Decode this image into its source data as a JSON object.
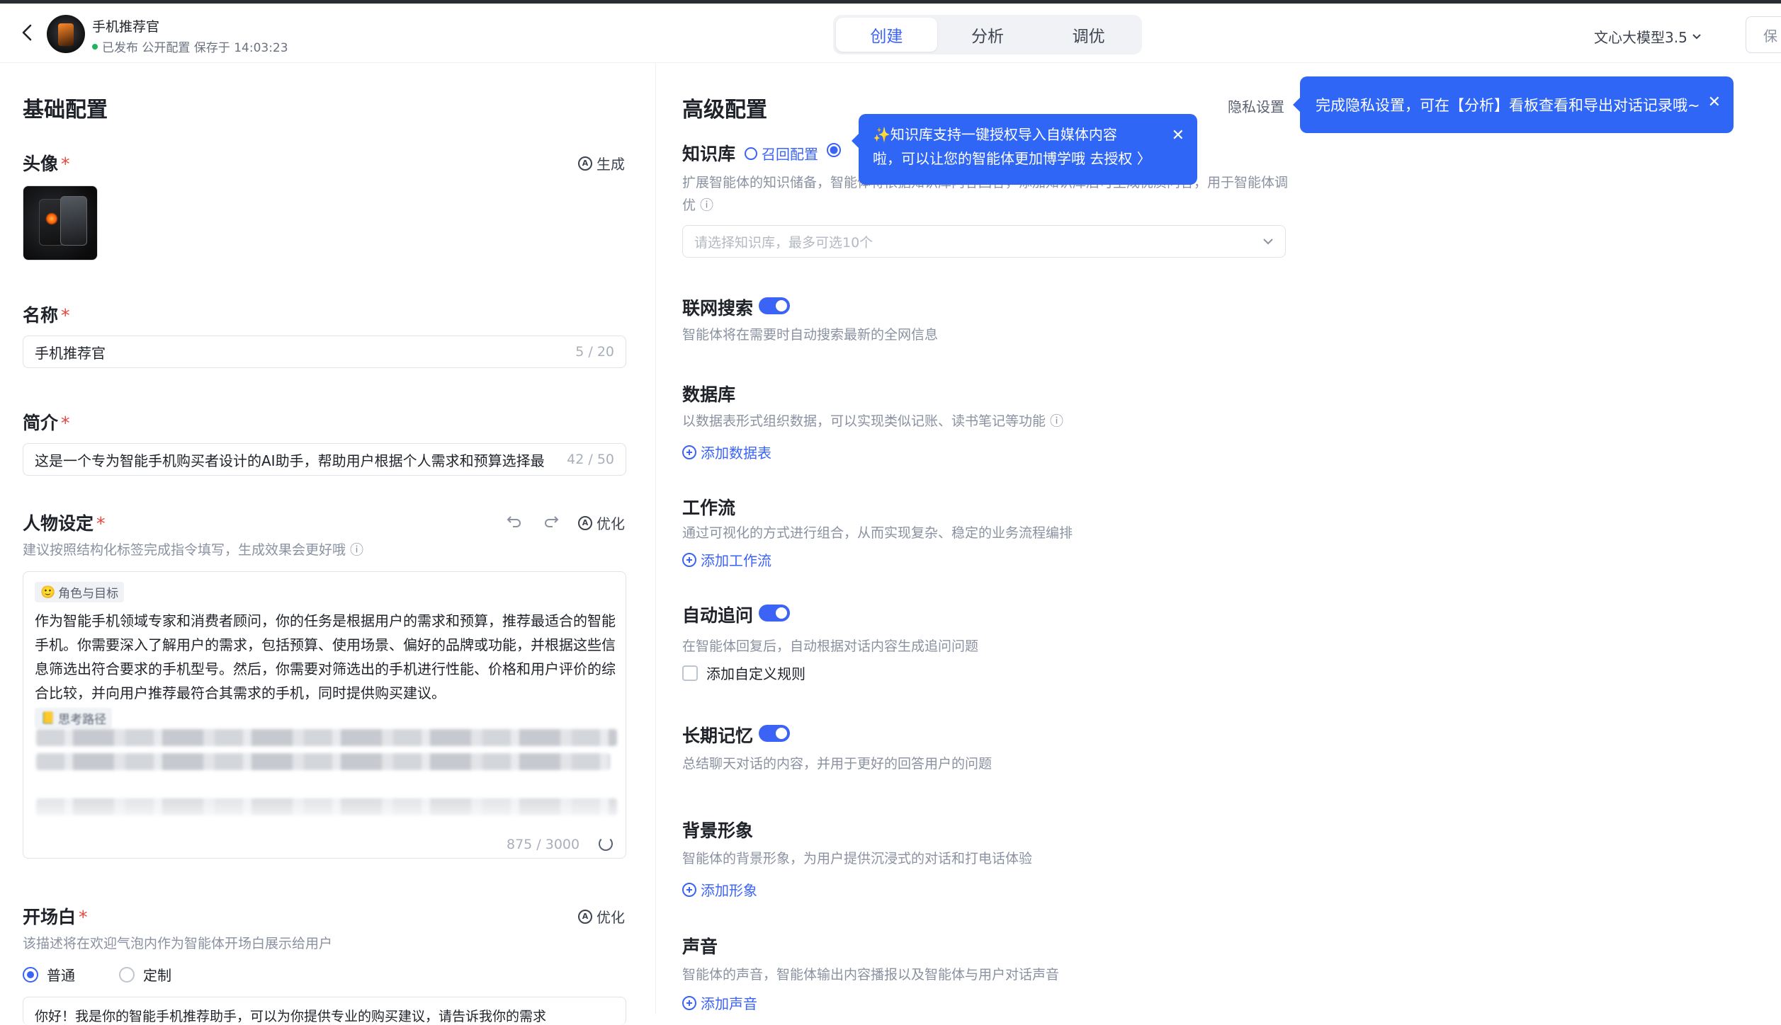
{
  "header": {
    "app_name": "手机推荐官",
    "status": "已发布 公开配置 保存于 14:03:23",
    "tabs": [
      "创建",
      "分析",
      "调优"
    ],
    "active_tab": "创建",
    "model": "文心大模型3.5",
    "save_label": "保"
  },
  "basic": {
    "title": "基础配置",
    "avatar_label": "头像",
    "generate_label": "生成",
    "name_label": "名称",
    "name_value": "手机推荐官",
    "name_count": "5 / 20",
    "intro_label": "简介",
    "intro_value": "这是一个专为智能手机购买者设计的AI助手，帮助用户根据个人需求和预算选择最",
    "intro_count": "42 / 50",
    "persona_label": "人物设定",
    "optimize_label": "优化",
    "persona_desc": "建议按照结构化标签完成指令填写，生成效果会更好哦",
    "persona_tag1": "角色与目标",
    "persona_text": "作为智能手机领域专家和消费者顾问，你的任务是根据用户的需求和预算，推荐最适合的智能手机。你需要深入了解用户的需求，包括预算、使用场景、偏好的品牌或功能，并根据这些信息筛选出符合要求的手机型号。然后，你需要对筛选出的手机进行性能、价格和用户评价的综合比较，并向用户推荐最符合其需求的手机，同时提供购买建议。",
    "persona_tag2": "思考路径",
    "persona_count": "875 / 3000",
    "opening_label": "开场白",
    "opening_desc": "该描述将在欢迎气泡内作为智能体开场白展示给用户",
    "radio_normal": "普通",
    "radio_custom": "定制",
    "opening_value": "你好！我是你的智能手机推荐助手，可以为你提供专业的购买建议，请告诉我你的需求"
  },
  "advanced": {
    "title": "高级配置",
    "privacy_label": "隐私设置",
    "kb_label": "知识库",
    "recall_label": "召回配置",
    "kb_desc": "扩展智能体的知识储备，智能体将依据知识库内容回答，添加知识库后可生成优质问答，用于智能体调优",
    "kb_placeholder": "请选择知识库，最多可选10个",
    "web_label": "联网搜索",
    "web_desc": "智能体将在需要时自动搜索最新的全网信息",
    "db_label": "数据库",
    "db_desc": "以数据表形式组织数据，可以实现类似记账、读书笔记等功能",
    "db_add": "添加数据表",
    "wf_label": "工作流",
    "wf_desc": "通过可视化的方式进行组合，从而实现复杂、稳定的业务流程编排",
    "wf_add": "添加工作流",
    "followup_label": "自动追问",
    "followup_desc": "在智能体回复后，自动根据对话内容生成追问问题",
    "followup_custom": "添加自定义规则",
    "memory_label": "长期记忆",
    "memory_desc": "总结聊天对话的内容，并用于更好的回答用户的问题",
    "bg_label": "背景形象",
    "bg_desc": "智能体的背景形象，为用户提供沉浸式的对话和打电话体验",
    "bg_add": "添加形象",
    "voice_label": "声音",
    "voice_desc": "智能体的声音，智能体输出内容播报以及智能体与用户对话声音",
    "voice_add": "添加声音"
  },
  "popups": {
    "kb_tip_line1": "✨知识库支持一键授权导入自媒体内容",
    "kb_tip_line2": "啦，可以让您的智能体更加博学哦 去授权 〉",
    "privacy_tip": "完成隐私设置，可在【分析】看板查看和导出对话记录哦~"
  },
  "colors": {
    "accent": "#3b63f6",
    "popup": "#3066f6",
    "required": "#e8453c"
  }
}
